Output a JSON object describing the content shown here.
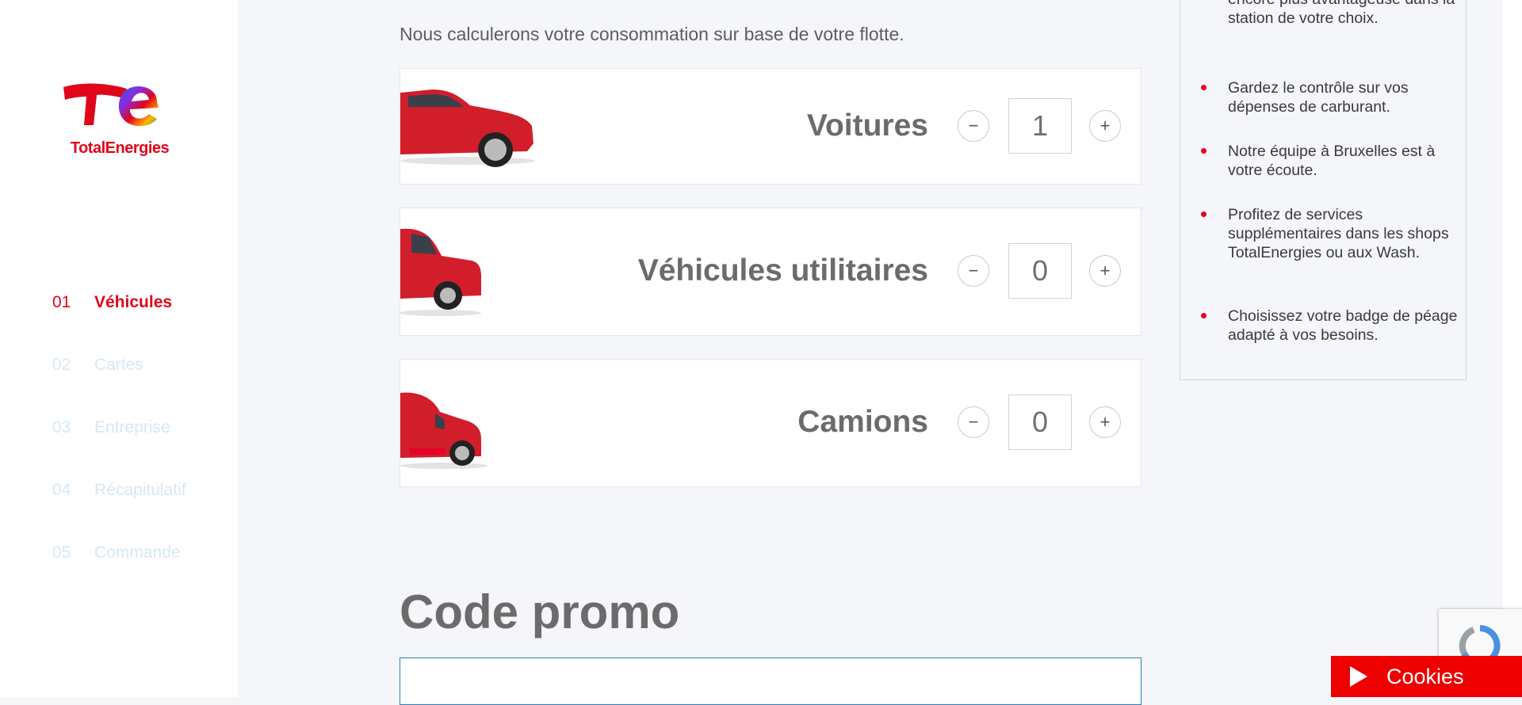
{
  "brand": {
    "name": "TotalEnergies"
  },
  "steps": [
    {
      "num": "01",
      "label": "Véhicules",
      "active": true
    },
    {
      "num": "02",
      "label": "Cartes",
      "active": false
    },
    {
      "num": "03",
      "label": "Entreprise",
      "active": false
    },
    {
      "num": "04",
      "label": "Récapitulatif",
      "active": false
    },
    {
      "num": "05",
      "label": "Commande",
      "active": false
    }
  ],
  "main": {
    "intro": "Nous calculerons votre consommation sur base de votre flotte.",
    "vehicles": [
      {
        "name": "Voitures",
        "value": "1",
        "minus": "−",
        "plus": "+"
      },
      {
        "name": "Véhicules utilitaires",
        "value": "0",
        "minus": "−",
        "plus": "+"
      },
      {
        "name": "Camions",
        "value": "0",
        "minus": "−",
        "plus": "+"
      }
    ],
    "promo_title": "Code promo",
    "promo_value": ""
  },
  "benefits": [
    "encore plus avantageuse dans la station de votre choix.",
    "Gardez le contrôle sur vos dépenses de carburant.",
    "Notre équipe à Bruxelles est à votre écoute.",
    "Profitez de services supplémentaires dans les shops TotalEnergies ou aux Wash.",
    "Choisissez votre badge de péage adapté à vos besoins."
  ],
  "cookies": {
    "label": "Cookies"
  },
  "colors": {
    "accent": "#e0051b",
    "cookie_bg": "#ee0000",
    "input_border": "#2e7fb8"
  }
}
